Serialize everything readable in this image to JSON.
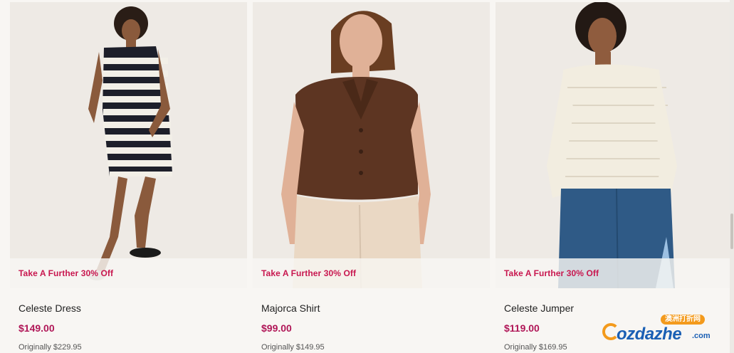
{
  "products": [
    {
      "promo": "Take A Further 30% Off",
      "name": "Celeste Dress",
      "price": "$149.00",
      "original": "Originally $229.95"
    },
    {
      "promo": "Take A Further 30% Off",
      "name": "Majorca Shirt",
      "price": "$99.00",
      "original": "Originally $149.95"
    },
    {
      "promo": "Take A Further 30% Off",
      "name": "Celeste Jumper",
      "price": "$119.00",
      "original": "Originally $169.95"
    }
  ],
  "watermark": {
    "badge": "澳洲打折网",
    "brand": "ozdazhe",
    "tld": ".com"
  },
  "colors": {
    "promo": "#c8174f",
    "price": "#b01657",
    "background": "#f8f6f3"
  }
}
